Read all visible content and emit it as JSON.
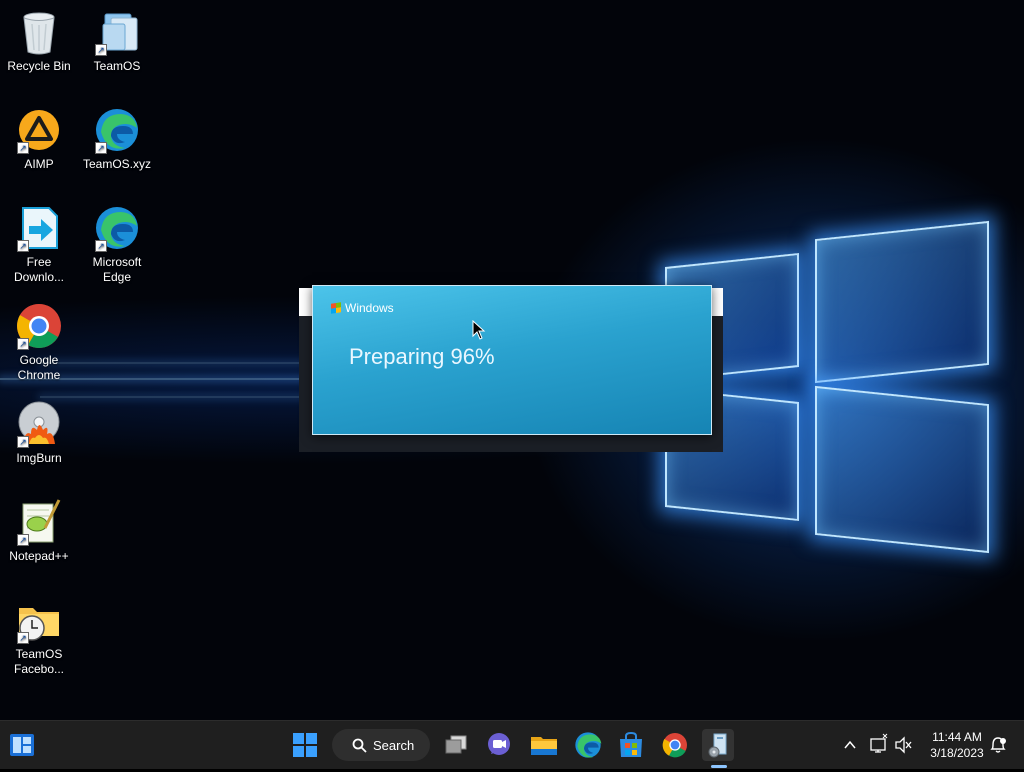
{
  "desktop": {
    "icons": [
      {
        "label": "Recycle Bin",
        "icon": "recycle-bin-icon"
      },
      {
        "label": "TeamOS",
        "icon": "teamos-icon"
      },
      {
        "label": "AIMP",
        "icon": "aimp-icon"
      },
      {
        "label": "TeamOS.xyz",
        "icon": "edge-icon"
      },
      {
        "label": "Free Downlo...",
        "icon": "free-download-icon"
      },
      {
        "label": "Microsoft Edge",
        "icon": "edge-icon"
      },
      {
        "label": "Google Chrome",
        "icon": "chrome-icon"
      },
      {
        "label": "ImgBurn",
        "icon": "imgburn-icon"
      },
      {
        "label": "Notepad++",
        "icon": "notepadpp-icon"
      },
      {
        "label": "TeamOS Facebo...",
        "icon": "folder-clock-icon"
      }
    ]
  },
  "setup_window": {
    "brand": "Windows",
    "status": "Preparing 96%",
    "progress_percent": 96
  },
  "taskbar": {
    "search_label": "Search",
    "apps": [
      "start-icon",
      "task-view-icon",
      "chat-icon",
      "file-explorer-icon",
      "edge-icon",
      "store-icon",
      "chrome-icon",
      "setup-icon"
    ],
    "widgets_icon": "widgets-icon",
    "tray": {
      "time": "11:44 AM",
      "date": "3/18/2023"
    }
  },
  "colors": {
    "taskbar_bg": "#1f1f1f",
    "setup_bg": "#2aa2cf",
    "accent": "#0078d4"
  }
}
